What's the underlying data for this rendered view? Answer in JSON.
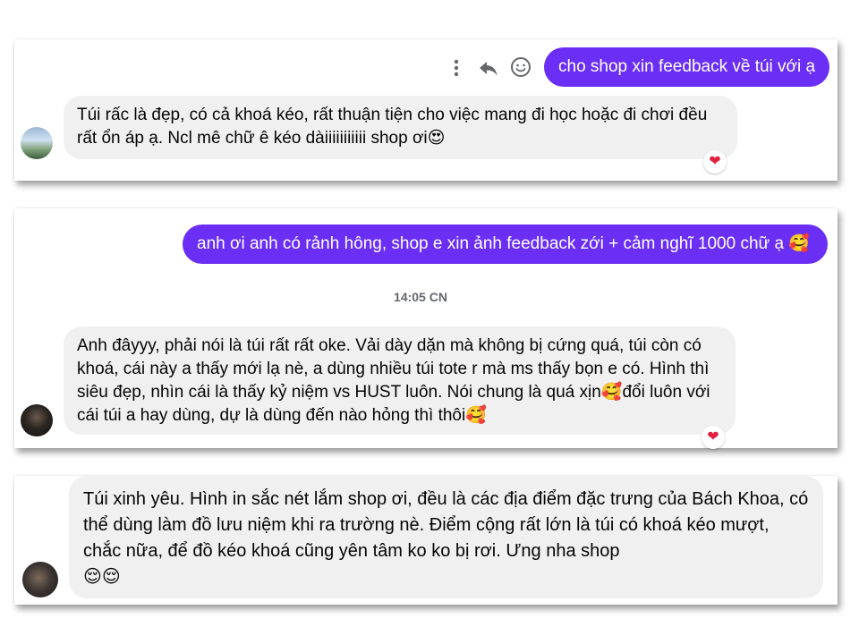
{
  "conversation_1": {
    "actions": {
      "more_icon": "more-vertical-icon",
      "reply_icon": "reply-icon",
      "react_icon": "smile-icon"
    },
    "sent_message": "cho shop xin feedback về túi với ạ",
    "received_message": "Túi rấc là đẹp, có cả khoá kéo, rất thuận tiện cho việc mang đi học hoặc đi chơi đều rất ổn áp ạ. Ncl mê chữ ê kéo dàiiiiiiiiiii shop ơi",
    "received_emoji": "😍",
    "reaction": "❤"
  },
  "conversation_2": {
    "sent_message": "anh ơi anh có rảnh hông,  shop e xin ảnh feedback zới + cảm nghĩ 1000 chữ ạ",
    "sent_emoji": "🥰",
    "timestamp": "14:05 CN",
    "received_part1": "Anh đâyyy, phải nói là túi rất rất oke. Vải dày dặn mà không bị cứng quá, túi còn có khoá, cái này a thấy mới lạ nè, a dùng nhiều túi tote r mà ms thấy bọn e có. Hình thì siêu đẹp, nhìn cái là thấy kỷ niệm vs HUST luôn. Nói chung là quá xịn",
    "received_emoji1": "🥰",
    "received_part2": "đổi luôn với cái túi a hay dùng, dự là dùng đến nào hỏng thì thôi",
    "received_emoji2": "🥰",
    "reaction": "❤"
  },
  "conversation_3": {
    "received_message": "Túi xinh yêu. Hình in sắc nét lắm shop ơi, đều là các địa điểm đặc trưng của Bách Khoa, có thể dùng làm đồ lưu niệm khi ra trường nè. Điểm cộng rất lớn là túi có khoá kéo mượt, chắc nữa, để đồ kéo khoá cũng yên tâm ko ko bị rơi. Ưng nha shop",
    "received_emojis": "😌😌"
  },
  "colors": {
    "sent_bubble": "#6a2ef5",
    "received_bubble": "#f0f0f0",
    "reaction_heart": "#e41e3f"
  }
}
